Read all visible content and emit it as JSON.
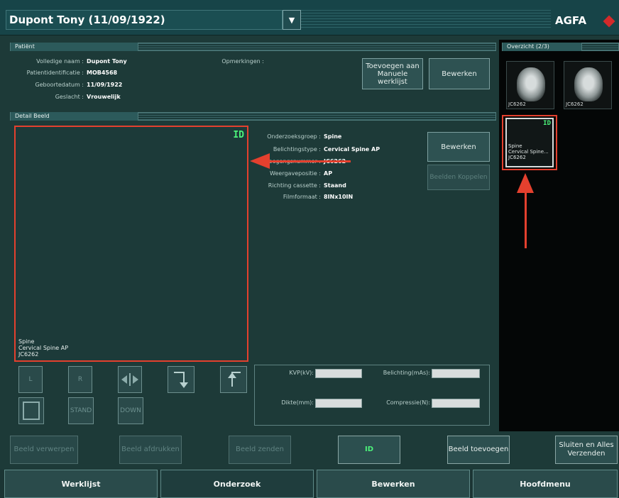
{
  "header": {
    "patient_title": "Dupont Tony (11/09/1922)",
    "brand": "AGFA",
    "brand_small": "Agfa"
  },
  "patient_panel": {
    "title": "Patiënt",
    "fields": [
      {
        "label": "Volledige naam :",
        "value": "Dupont Tony"
      },
      {
        "label": "Patientidentificatie :",
        "value": "MOB4568"
      },
      {
        "label": "Geboortedatum :",
        "value": "11/09/1922"
      },
      {
        "label": "Geslacht :",
        "value": "Vrouwelijk"
      }
    ],
    "remarks_label": "Opmerkingen :",
    "add_button": "Toevoegen aan Manuele werklijst",
    "edit_button": "Bewerken"
  },
  "detail_panel": {
    "title": "Detail Beeld",
    "id_mark": "ID",
    "image_caption": [
      "Spine",
      "Cervical Spine AP",
      "JC6262"
    ],
    "fields": [
      {
        "label": "Onderzoeksgroep :",
        "value": "Spine"
      },
      {
        "label": "Belichtingstype :",
        "value": "Cervical Spine AP"
      },
      {
        "label": "Toegangsnummer :",
        "value": "JC6262"
      },
      {
        "label": "Weergavepositie :",
        "value": "AP"
      },
      {
        "label": "Richting cassette :",
        "value": "Staand"
      },
      {
        "label": "Filmformaat :",
        "value": "8INx10IN"
      }
    ],
    "edit_button": "Bewerken",
    "link_button": "Beelden Koppelen"
  },
  "tools": {
    "left_marker": "L",
    "right_marker": "R",
    "flip_icon": "flip-horizontal-icon",
    "rotate_cw_icon": "rotate-clockwise-icon",
    "rotate_ccw_icon": "rotate-counterclockwise-icon",
    "stand": "STAND",
    "down": "DOWN"
  },
  "exposure": {
    "kvp_label": "KVP(kV):",
    "mas_label": "Belichting(mAs):",
    "thickness_label": "Dikte(mm):",
    "compression_label": "Compressie(N):"
  },
  "overview": {
    "title": "Overzicht (2/3)",
    "thumbs": [
      {
        "code": "JC6262"
      },
      {
        "code": "JC6262"
      }
    ],
    "selected": {
      "id": "ID",
      "lines": [
        "Spine",
        "Cervical Spine...",
        "JC6262"
      ]
    }
  },
  "actions": {
    "reject": "Beeld verwerpen",
    "print": "Beeld afdrukken",
    "send": "Beeld zenden",
    "id": "ID",
    "add_image": "Beeld toevoegen",
    "close_send": "Sluiten en Alles Verzenden"
  },
  "tabs": [
    "Werklijst",
    "Onderzoek",
    "Bewerken",
    "Hoofdmenu"
  ],
  "colors": {
    "annotation_red": "#e4402e",
    "id_green": "#4cf27a"
  }
}
